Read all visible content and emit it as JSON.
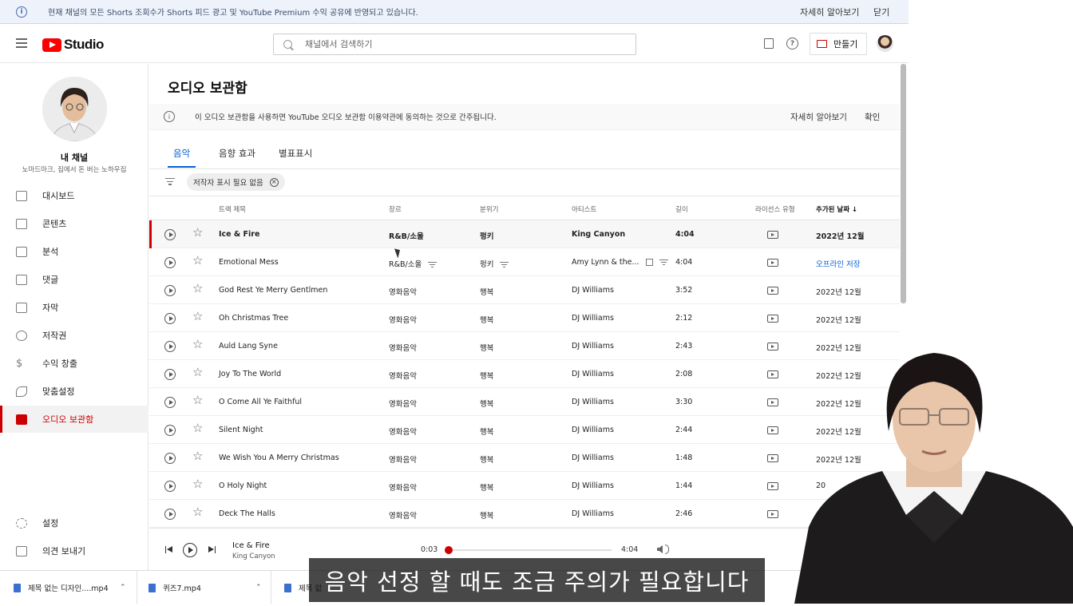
{
  "banner": {
    "message": "현재 채널의 모든 Shorts 조회수가 Shorts 피드 광고 및 YouTube Premium 수익 공유에 반영되고 있습니다.",
    "learn_more": "자세히 알아보기",
    "close": "닫기"
  },
  "header": {
    "logo_text": "Studio",
    "search_placeholder": "채널에서 검색하기",
    "create_label": "만들기"
  },
  "channel": {
    "title": "내 채널",
    "name": "노마드마크, 집에서 돈 버는 노하우집"
  },
  "sidebar": {
    "items": [
      {
        "label": "대시보드",
        "icon": "dashboard-icon"
      },
      {
        "label": "콘텐츠",
        "icon": "content-icon"
      },
      {
        "label": "분석",
        "icon": "analytics-icon"
      },
      {
        "label": "댓글",
        "icon": "comments-icon"
      },
      {
        "label": "자막",
        "icon": "subtitles-icon"
      },
      {
        "label": "저작권",
        "icon": "copyright-icon"
      },
      {
        "label": "수익 창출",
        "icon": "monetization-icon"
      },
      {
        "label": "맞춤설정",
        "icon": "customization-icon"
      },
      {
        "label": "오디오 보관함",
        "icon": "audio-library-icon"
      }
    ],
    "settings": "설정",
    "feedback": "의견 보내기"
  },
  "page": {
    "title": "오디오 보관함",
    "notice": "이 오디오 보관함을 사용하면 YouTube 오디오 보관함 이용약관에 동의하는 것으로 간주됩니다.",
    "notice_more": "자세히 알아보기",
    "notice_ok": "확인",
    "tabs": [
      "음악",
      "음향 효과",
      "별표표시"
    ],
    "filter_chip": "저작자 표시 필요 없음",
    "columns": {
      "title": "트랙 제목",
      "genre": "장르",
      "mood": "분위기",
      "artist": "아티스트",
      "duration": "길이",
      "license": "라이선스 유형",
      "added": "추가된 날짜"
    },
    "rows": [
      {
        "title": "Ice & Fire",
        "genre": "R&B/소울",
        "mood": "펑키",
        "artist": "King Canyon",
        "duration": "4:04",
        "added": "2022년 12월"
      },
      {
        "title": "Emotional Mess",
        "genre": "R&B/소울",
        "mood": "펑키",
        "artist": "Amy Lynn & the...",
        "duration": "4:04",
        "added": "오프라인 저장"
      },
      {
        "title": "God Rest Ye Merry Gentlmen",
        "genre": "영화음악",
        "mood": "행복",
        "artist": "DJ Williams",
        "duration": "3:52",
        "added": "2022년 12월"
      },
      {
        "title": "Oh Christmas Tree",
        "genre": "영화음악",
        "mood": "행복",
        "artist": "DJ Williams",
        "duration": "2:12",
        "added": "2022년 12월"
      },
      {
        "title": "Auld Lang Syne",
        "genre": "영화음악",
        "mood": "행복",
        "artist": "DJ Williams",
        "duration": "2:43",
        "added": "2022년 12월"
      },
      {
        "title": "Joy To The World",
        "genre": "영화음악",
        "mood": "행복",
        "artist": "DJ Williams",
        "duration": "2:08",
        "added": "2022년 12월"
      },
      {
        "title": "O Come All Ye Faithful",
        "genre": "영화음악",
        "mood": "행복",
        "artist": "DJ Williams",
        "duration": "3:30",
        "added": "2022년 12월"
      },
      {
        "title": "Silent Night",
        "genre": "영화음악",
        "mood": "행복",
        "artist": "DJ Williams",
        "duration": "2:44",
        "added": "2022년 12월"
      },
      {
        "title": "We Wish You A Merry Christmas",
        "genre": "영화음악",
        "mood": "행복",
        "artist": "DJ Williams",
        "duration": "1:48",
        "added": "2022년 12월"
      },
      {
        "title": "O Holy Night",
        "genre": "영화음악",
        "mood": "행복",
        "artist": "DJ Williams",
        "duration": "1:44",
        "added": "20"
      },
      {
        "title": "Deck The Halls",
        "genre": "영화음악",
        "mood": "행복",
        "artist": "DJ Williams",
        "duration": "2:46",
        "added": ""
      }
    ]
  },
  "player": {
    "track": "Ice & Fire",
    "artist": "King Canyon",
    "current": "0:03",
    "total": "4:04",
    "progress": 0.012
  },
  "downloads": [
    {
      "name": "제목 없는 디자인....mp4"
    },
    {
      "name": "퀴즈7.mp4"
    },
    {
      "name": "제목 없"
    }
  ],
  "overlay_subtitle": "음악 선정 할 때도 조금 주의가 필요합니다",
  "colors": {
    "accent": "#cc0000",
    "link": "#065fd4"
  }
}
